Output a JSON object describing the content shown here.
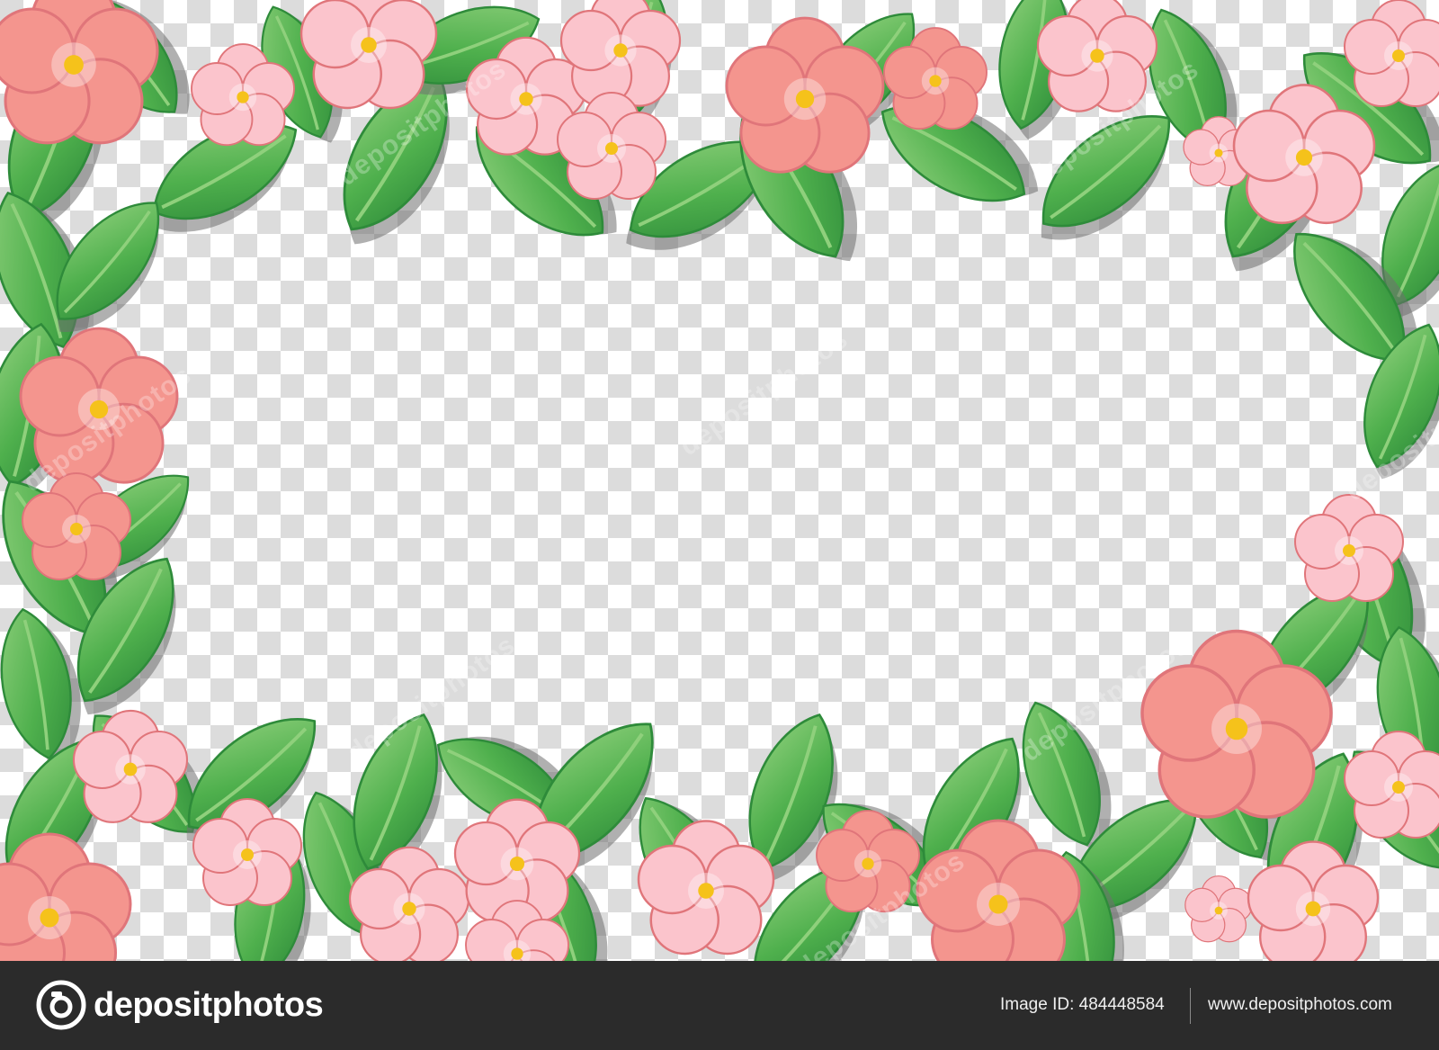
{
  "image": {
    "description_icons": [
      "leaf-icon",
      "flower-icon",
      "camera-icon"
    ],
    "colors": {
      "checker_light": "#ffffff",
      "checker_dark": "#dcdcdc",
      "leaf_dark": "#2e8b3a",
      "leaf_mid": "#4fb04d",
      "leaf_light": "#8fd07c",
      "shadow": "#6f6f6f",
      "flower_coral": "#f4958e",
      "flower_pink": "#fbc4cc",
      "flower_center": "#f5c21b",
      "footer_bg": "#2b2b2b"
    }
  },
  "watermark": {
    "text": "depositphotos"
  },
  "footer": {
    "brand_name": "depositphotos",
    "image_id": "Image ID: 484448584",
    "site_url": "www.depositphotos.com"
  }
}
